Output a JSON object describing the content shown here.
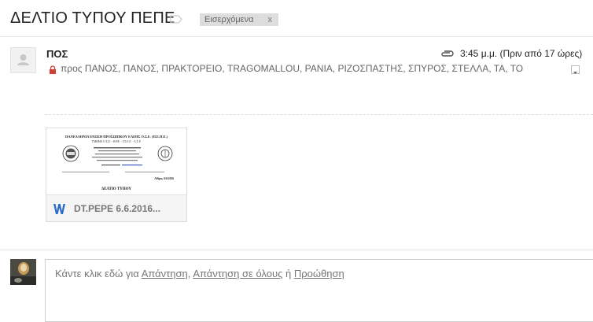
{
  "subject": "ΔΕΛΤΙΟ ΤΥΠΟΥ ΠΕΠΕ",
  "label": {
    "name": "Εισερχόμενα",
    "remove": "x"
  },
  "message": {
    "sender": "ΠΟΣ",
    "time": "3:45 μ.μ. (Πριν από 17 ώρες)",
    "recipients": "προς ΠΑΝΟΣ, ΠΑΝΟΣ, ΠΡΑΚΤΟΡΕΙΟ, TRAGOMALLOU, ΡΑΝΙΑ, ΡΙΖΟΣΠΑΣΤΗΣ, ΣΠΥΡΟΣ, ΣΤΕΛΛΑ, ΤΑ, ΤΟ"
  },
  "attachment": {
    "filename": "DT.PEPE 6.6.2016...",
    "preview": {
      "org_line1": "ΠΑΝΕΛΛΗΝΙΑ ΕΝΩΣΗ ΠΡΟΣΩΠΙΚΟΥ ΕΛΕΗΣ Ο.Σ.Ε. (Π.Ε.Π.Ε.)",
      "org_line2": "ΤΜΗΜΑ Ο.Σ.Ε. - Θ.ΒΕ. - Γ.Σ.Ε.Ε. - Α.Σ.Ρ.",
      "date": "Αθήνα, 6/6/2016",
      "title": "ΔΕΛΤΙΟ ΤΥΠΟΥ"
    }
  },
  "reply": {
    "prefix": "Κάντε κλικ εδώ για",
    "reply_link": "Απάντηση",
    "sep1": ",",
    "reply_all_link": "Απάντηση σε όλους",
    "or": "ή",
    "forward_link": "Προώθηση"
  },
  "colors": {
    "word_blue": "#2a6bc9",
    "corner_blue": "#2a7be4",
    "chip_bg": "#dddddd",
    "lock_red": "#d23f31"
  },
  "icons": [
    "label-outline-icon",
    "attachment-clip-icon",
    "lock-icon",
    "chevron-down-icon",
    "word-doc-icon",
    "avatar-placeholder-icon"
  ]
}
